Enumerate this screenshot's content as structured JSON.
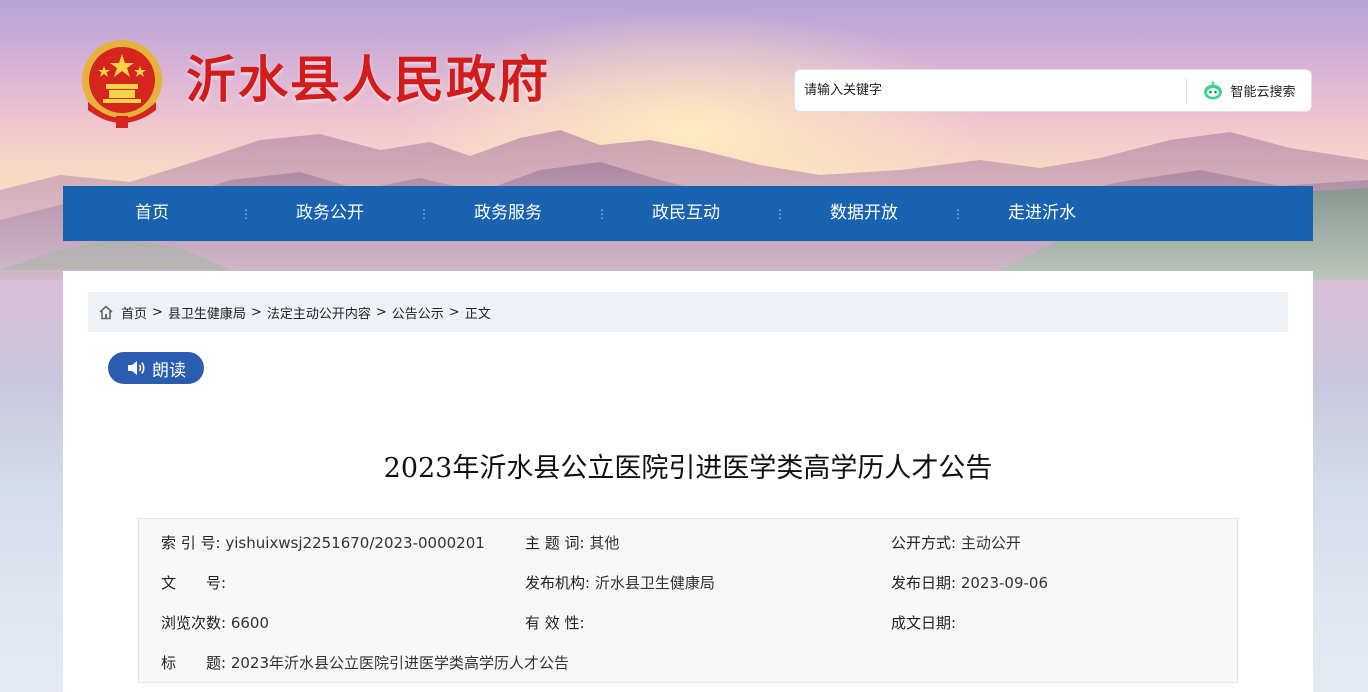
{
  "header": {
    "site_title": "沂水县人民政府",
    "search_placeholder": "请输入关键字",
    "search_button": "智能云搜索"
  },
  "nav": {
    "items": [
      "首页",
      "政务公开",
      "政务服务",
      "政民互动",
      "数据开放",
      "走进沂水"
    ],
    "separator": "⋮"
  },
  "breadcrumb": {
    "items": [
      "首页",
      "县卫生健康局",
      "法定主动公开内容",
      "公告公示",
      "正文"
    ],
    "separator": ">"
  },
  "read_button": "朗读",
  "article": {
    "title": "2023年沂水县公立医院引进医学类高学历人才公告"
  },
  "meta": {
    "index_label": "索 引 号:",
    "index_value": "yishuixwsj2251670/2023-0000201",
    "subject_label": "主 题 词:",
    "subject_value": "其他",
    "open_mode_label": "公开方式:",
    "open_mode_value": "主动公开",
    "doc_no_label": "文　　号:",
    "doc_no_value": "",
    "publisher_label": "发布机构:",
    "publisher_value": "沂水县卫生健康局",
    "publish_date_label": "发布日期:",
    "publish_date_value": "2023-09-06",
    "views_label": "浏览次数:",
    "views_value": "6600",
    "validity_label": "有 效 性:",
    "validity_value": "",
    "created_date_label": "成文日期:",
    "created_date_value": "",
    "title_label": "标　　题:",
    "title_value": "2023年沂水县公立医院引进医学类高学历人才公告"
  },
  "colors": {
    "nav_bg": "#1862b0",
    "title_red": "#d21b1b",
    "read_button_bg": "#2a5cb0",
    "breadcrumb_bg": "#eef2f8"
  }
}
